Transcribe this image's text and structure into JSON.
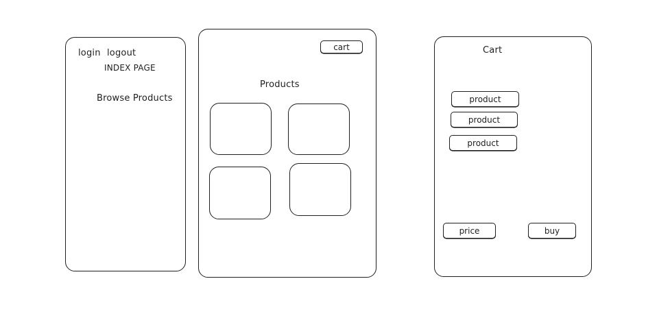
{
  "index_screen": {
    "login_label": "login",
    "logout_label": "logout",
    "title": "INDEX PAGE",
    "browse_label": "Browse Products"
  },
  "products_screen": {
    "cart_button": "cart",
    "title": "Products",
    "product_tiles": [
      "",
      "",
      "",
      ""
    ]
  },
  "cart_screen": {
    "title": "Cart",
    "items": [
      "product",
      "product",
      "product"
    ],
    "price_button": "price",
    "buy_button": "buy"
  }
}
